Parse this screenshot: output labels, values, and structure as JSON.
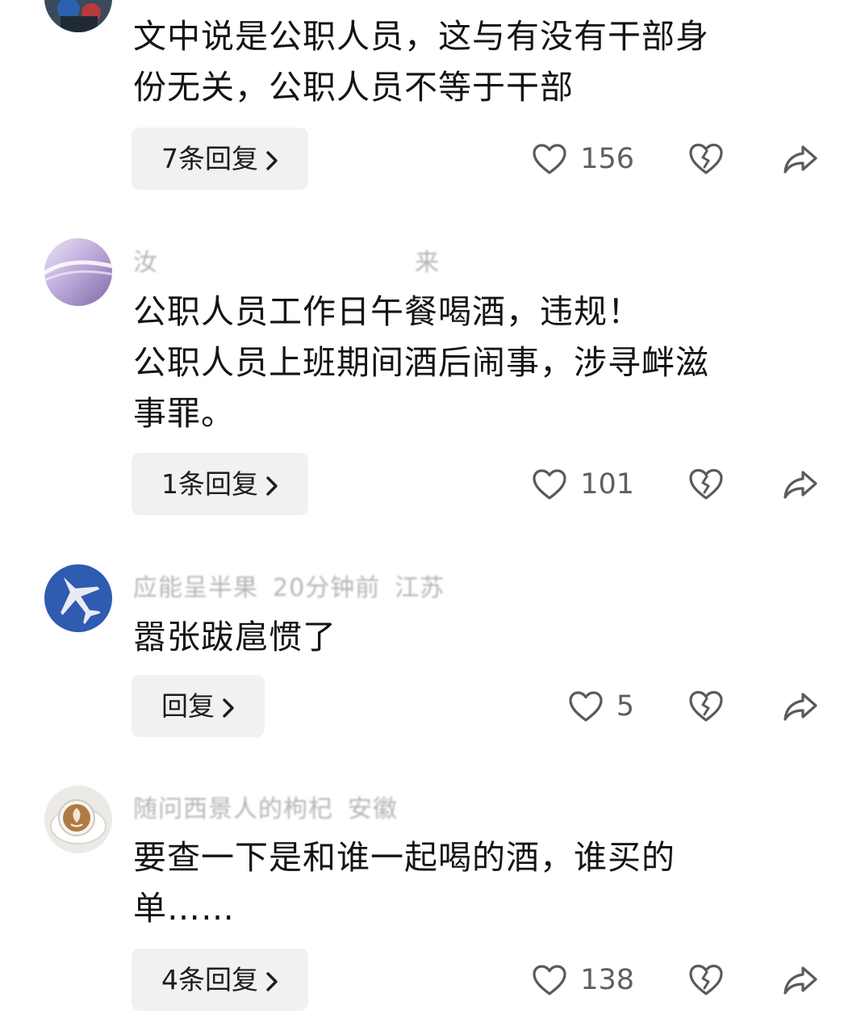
{
  "comments": [
    {
      "meta_name": "",
      "meta_time": "",
      "meta_location": "",
      "text_lines": [
        "文中说是公职人员，这与有没有干部身",
        "份无关，公职人员不等于干部"
      ],
      "reply_label": "7条回复",
      "likes": "156",
      "avatar": "figure-avatar"
    },
    {
      "meta_name": "汝",
      "meta_time": "",
      "meta_location": "来",
      "text_lines": [
        "公职人员工作日午餐喝酒，违规！",
        "公职人员上班期间酒后闹事，涉寻衅滋",
        "事罪。"
      ],
      "reply_label": "1条回复",
      "likes": "101",
      "avatar": "purple-wave-avatar"
    },
    {
      "meta_name": "应能呈半果",
      "meta_time": "20分钟前",
      "meta_location": "江苏",
      "text_lines": [
        "嚣张跋扈惯了"
      ],
      "reply_label": "回复",
      "likes": "5",
      "avatar": "jet-avatar"
    },
    {
      "meta_name": "随问西景人的枸杞",
      "meta_time": "",
      "meta_location": "安徽",
      "text_lines": [
        "要查一下是和谁一起喝的酒，谁买的",
        "单……"
      ],
      "reply_label": "4条回复",
      "likes": "138",
      "avatar": "coffee-avatar"
    }
  ],
  "icons": {
    "like": "heart-outline-icon",
    "dislike": "broken-heart-icon",
    "share": "share-arrow-icon",
    "chevron": "chevron-right-icon"
  },
  "colors": {
    "text": "#141414",
    "meta": "#b5b5b5",
    "count": "#5f5f5f",
    "button_bg": "#f1f1f1",
    "icon": "#5a5a5a"
  }
}
